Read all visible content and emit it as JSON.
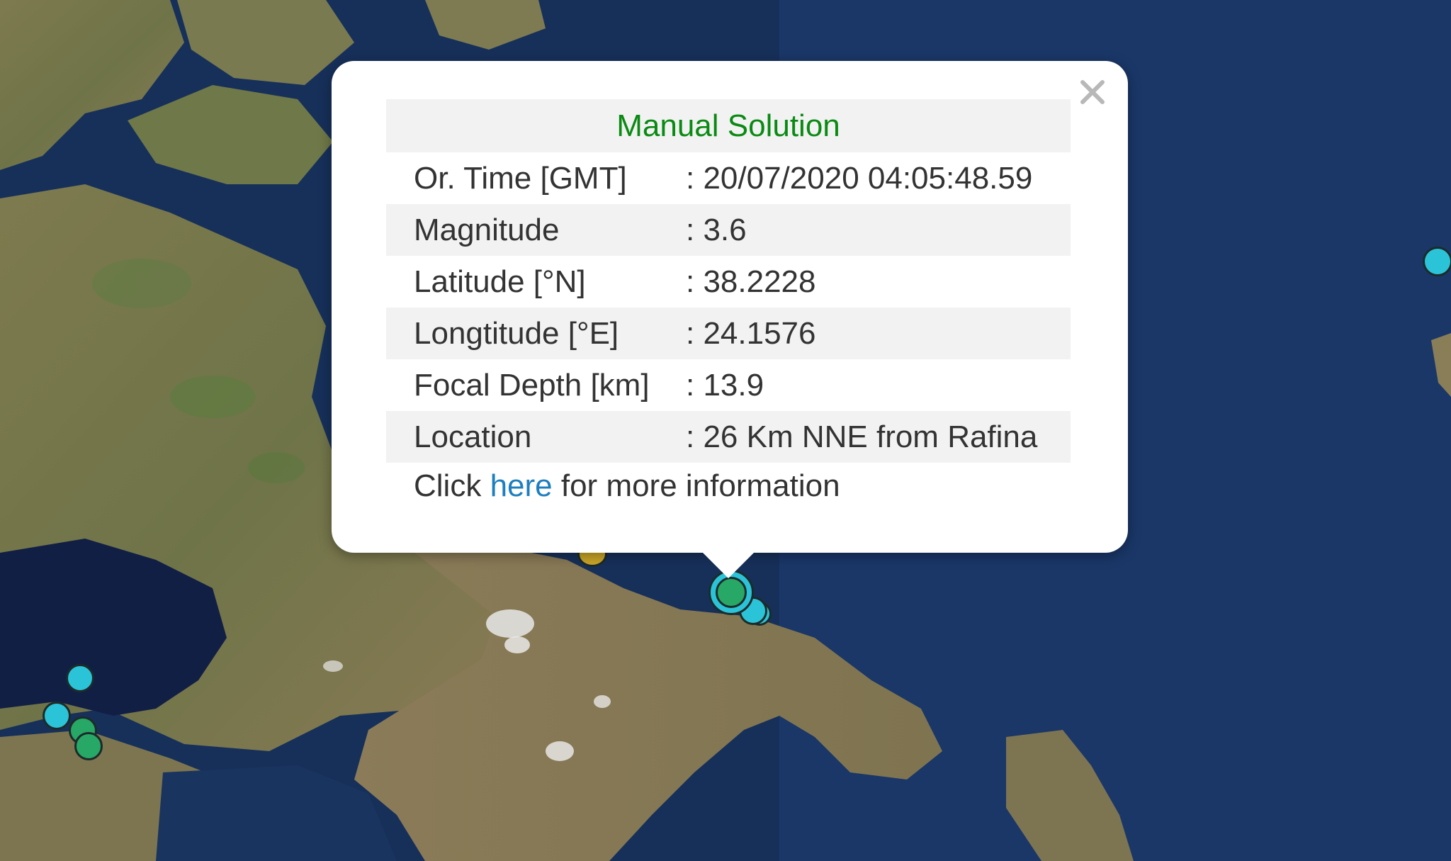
{
  "popup": {
    "title": "Manual Solution",
    "close_glyph": "×",
    "rows": [
      {
        "label": "Or. Time [GMT]",
        "value": ": 20/07/2020 04:05:48.59"
      },
      {
        "label": "Magnitude",
        "value": ": 3.6"
      },
      {
        "label": "Latitude [°N]",
        "value": ": 38.2228"
      },
      {
        "label": "Longtitude [°E]",
        "value": ": 24.1576"
      },
      {
        "label": "Focal Depth [km]",
        "value": ": 13.9"
      },
      {
        "label": "Location",
        "value": ": 26 Km NNE from Rafina"
      }
    ],
    "footer": {
      "prefix": "Click ",
      "link_text": "here",
      "suffix": " for more information"
    }
  },
  "colors": {
    "title_green": "#0a8a13",
    "link_blue": "#1e7fbf",
    "marker_cyan": "#2bc3d8",
    "marker_green": "#27a866",
    "marker_yellow": "#c9a528",
    "sea": "#17305a"
  },
  "icons": {
    "close": "close-icon"
  }
}
